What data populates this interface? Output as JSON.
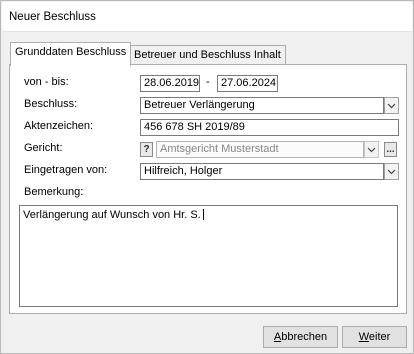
{
  "window": {
    "title": "Neuer Beschluss"
  },
  "tabs": [
    {
      "label": "Grunddaten Beschluss"
    },
    {
      "label": "Betreuer und Beschluss Inhalt"
    }
  ],
  "form": {
    "von_bis": {
      "label": "von - bis:",
      "from": "28.06.2019",
      "separator": "-",
      "to": "27.06.2024"
    },
    "beschluss": {
      "label": "Beschluss:",
      "value": "Betreuer Verlängerung"
    },
    "aktenzeichen": {
      "label": "Aktenzeichen:",
      "value": "456 678 SH 2019/89"
    },
    "gericht": {
      "label": "Gericht:",
      "help_label": "?",
      "value": "Amtsgericht Musterstadt",
      "more_label": "..."
    },
    "eingetragen": {
      "label": "Eingetragen von:",
      "value": "Hilfreich, Holger"
    },
    "bemerkung": {
      "label": "Bemerkung:",
      "value": "Verlängerung auf Wunsch von Hr. S."
    }
  },
  "buttons": {
    "cancel": {
      "mnemonic": "A",
      "rest": "bbrechen"
    },
    "next": {
      "mnemonic": "W",
      "rest": "eiter"
    }
  },
  "icons": {
    "combo": "chevron-down-icon"
  }
}
